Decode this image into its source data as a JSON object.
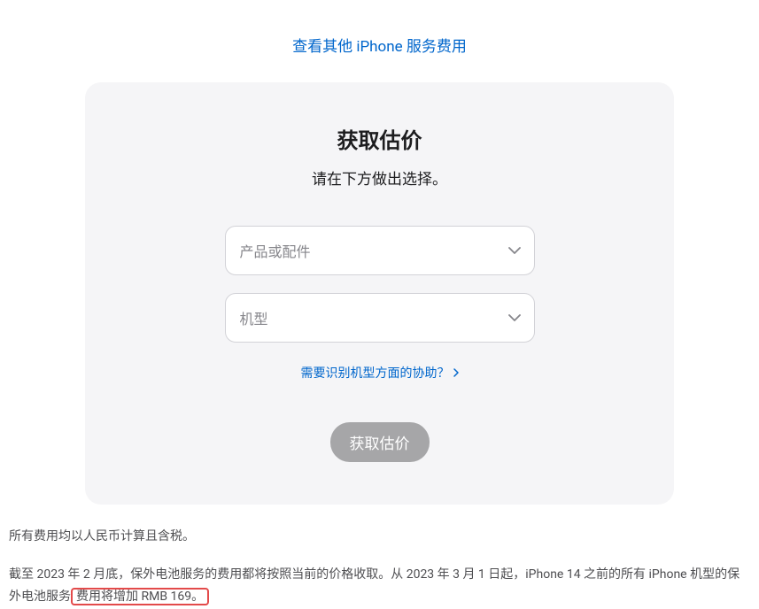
{
  "topLink": "查看其他 iPhone 服务费用",
  "card": {
    "title": "获取估价",
    "subtitle": "请在下方做出选择。",
    "select1": "产品或配件",
    "select2": "机型",
    "helpLink": "需要识别机型方面的协助？",
    "submitLabel": "获取估价"
  },
  "footer": {
    "line1": "所有费用均以人民币计算且含税。",
    "line2_part1": "截至 2023 年 2 月底，保外电池服务的费用都将按照当前的价格收取。从 2023 年 3 月 1 日起，iPhone 14 之前的所有 iPhone 机型的保外电池服务",
    "line2_highlight": "费用将增加 RMB 169。"
  }
}
